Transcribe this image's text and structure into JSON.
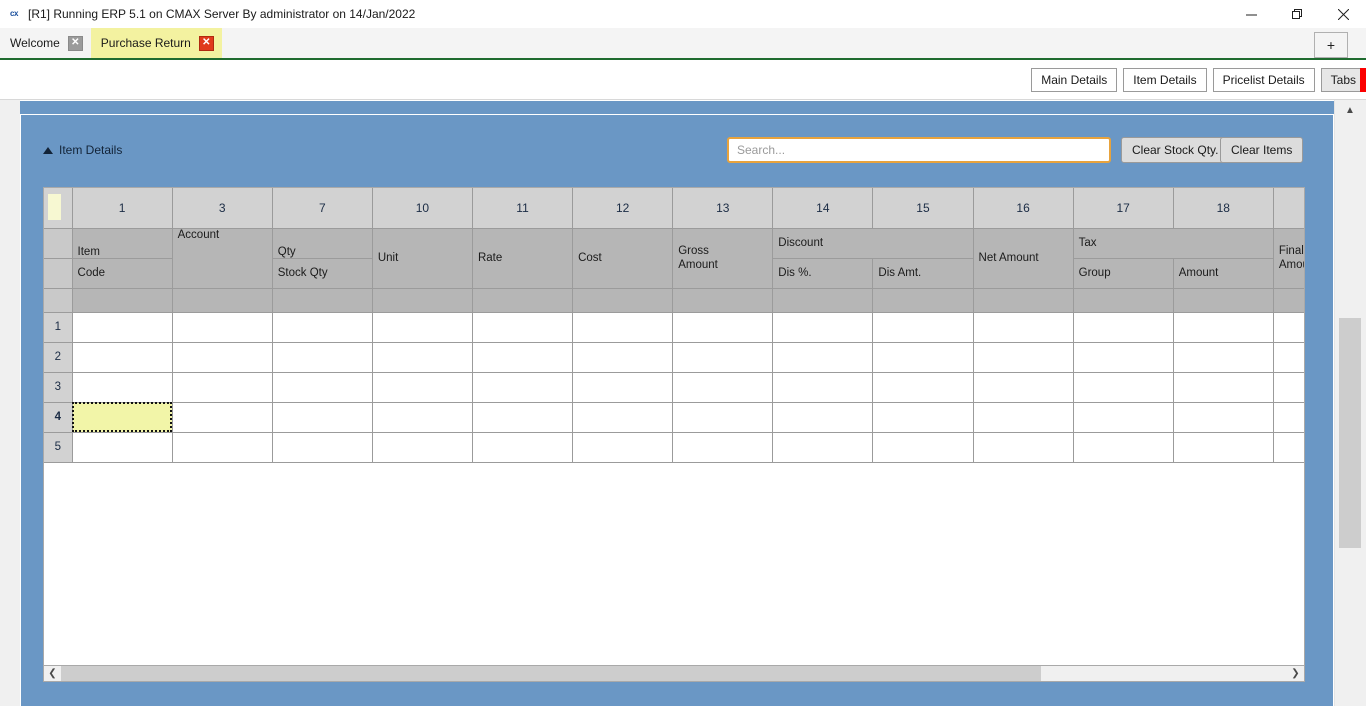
{
  "window": {
    "icon": "app-logo-icon",
    "icon_text": "cx",
    "title": "[R1] Running ERP 5.1 on CMAX Server By administrator on 14/Jan/2022",
    "controls": {
      "minimize": "minimize-icon",
      "restore": "restore-icon",
      "close": "close-icon"
    }
  },
  "tabs": {
    "items": [
      {
        "label": "Welcome",
        "active": false,
        "close": "✕"
      },
      {
        "label": "Purchase Return",
        "active": true,
        "close": "✕"
      }
    ],
    "new_tab_label": "+"
  },
  "toolbar": {
    "buttons": [
      {
        "label": "Main Details"
      },
      {
        "label": "Item Details"
      },
      {
        "label": "Pricelist Details"
      },
      {
        "label": "Tabs"
      }
    ]
  },
  "section": {
    "collapse_icon": "triangle-up-icon",
    "title": "Item Details"
  },
  "search": {
    "placeholder": "Search...",
    "value": ""
  },
  "actions": {
    "clear_stock_qty": "Clear Stock Qty.",
    "clear_items": "Clear Items"
  },
  "grid": {
    "column_numbers": [
      "",
      "1",
      "3",
      "7",
      "10",
      "11",
      "12",
      "13",
      "14",
      "15",
      "16",
      "17",
      "18",
      ""
    ],
    "header_row_1": [
      "",
      "Item",
      "Account",
      "Qty",
      "Unit",
      "Rate",
      "Cost",
      "Gross\nAmount",
      "Discount",
      "",
      "Net Amount",
      "Tax",
      "",
      "Final\nAmou"
    ],
    "header_labels": {
      "item": "Item",
      "code": "Code",
      "account": "Account",
      "qty": "Qty",
      "stock_qty": "Stock Qty",
      "unit": "Unit",
      "rate": "Rate",
      "cost": "Cost",
      "gross_amount_l1": "Gross",
      "gross_amount_l2": "Amount",
      "discount": "Discount",
      "dis_pct": "Dis %.",
      "dis_amt": "Dis Amt.",
      "net_amount": "Net Amount",
      "tax": "Tax",
      "tax_group": "Group",
      "tax_amount": "Amount",
      "final_amount_l1": "Final",
      "final_amount_l2": "Amou"
    },
    "rows": [
      {
        "num": "1",
        "selected": false
      },
      {
        "num": "2",
        "selected": false
      },
      {
        "num": "3",
        "selected": false
      },
      {
        "num": "4",
        "selected": true
      },
      {
        "num": "5",
        "selected": false
      }
    ],
    "active_cell": {
      "row": "4",
      "column": "1",
      "value": ""
    }
  },
  "scrollbars": {
    "h_left_arrow": "❮",
    "h_right_arrow": "❯",
    "v_up_arrow": "▲"
  },
  "colors": {
    "panel_blue": "#6a97c5",
    "active_tab_yellow": "#f3f2a0",
    "tab_close_red": "#e03a1c",
    "accent_green": "#1f6b2f",
    "search_focus_orange": "#e8a33d",
    "active_cell_yellow": "#f2f5a8",
    "flag_red": "#fb0000"
  }
}
